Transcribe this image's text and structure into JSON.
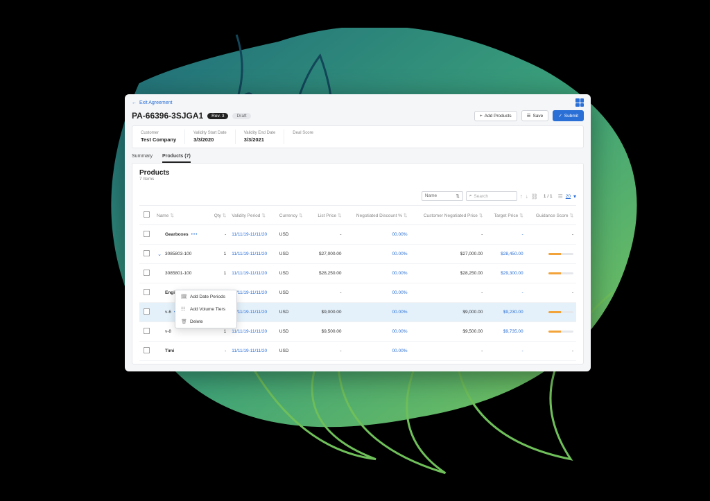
{
  "topbar": {
    "exit_label": "Exit Agreement"
  },
  "header": {
    "title": "PA-66396-3SJGA1",
    "rev_badge": "Rev. 3",
    "status_badge": "Draft",
    "add_products_btn": "Add Products",
    "save_btn": "Save",
    "submit_btn": "Submit"
  },
  "info": {
    "customer_label": "Customer",
    "customer_value": "Test Company",
    "start_label": "Validity Start Date",
    "start_value": "3/3/2020",
    "end_label": "Validity End Date",
    "end_value": "3/3/2021",
    "deal_score_label": "Deal Score",
    "deal_score_value": ""
  },
  "tabs": {
    "summary": "Summary",
    "products": "Products (7)"
  },
  "products": {
    "section_title": "Products",
    "item_count": "7 Items",
    "toolbar": {
      "name_filter": "Name",
      "search_placeholder": "Search",
      "pager": "1 / 1",
      "pagesize": "20"
    },
    "columns": {
      "name": "Name",
      "qty": "Qty",
      "validity": "Validity Period",
      "currency": "Currency",
      "list_price": "List Price",
      "neg_disc": "Negotiated Discount %",
      "cust_neg": "Customer Negotiated Price",
      "target": "Target Price",
      "guidance": "Guidance Score"
    },
    "rows": [
      {
        "name": "Gearboxes",
        "bold": true,
        "elips": true,
        "qty": "-",
        "validity": "11/11/19-11/11/20",
        "currency": "USD",
        "list_price": "-",
        "neg_disc": "00.00%",
        "cust_neg": "-",
        "target": "-",
        "guidance": false
      },
      {
        "name": "3085803-100",
        "bold": false,
        "caret": true,
        "elips": false,
        "qty": "1",
        "validity": "11/11/19-11/11/20",
        "currency": "USD",
        "list_price": "$27,000.00",
        "neg_disc": "00.00%",
        "cust_neg": "$27,000.00",
        "target": "$28,450.00",
        "guidance": true
      },
      {
        "name": "3085801-100",
        "bold": false,
        "elips": false,
        "qty": "1",
        "validity": "11/11/19-11/11/20",
        "currency": "USD",
        "list_price": "$28,250.00",
        "neg_disc": "00.00%",
        "cust_neg": "$28,250.00",
        "target": "$29,300.00",
        "guidance": true
      },
      {
        "name": "Engines",
        "bold": true,
        "elips": true,
        "qty": "-",
        "validity": "11/11/19-11/11/20",
        "currency": "USD",
        "list_price": "-",
        "neg_disc": "00.00%",
        "cust_neg": "-",
        "target": "-",
        "guidance": false
      },
      {
        "name": "v-6",
        "bold": false,
        "elips": true,
        "selected": true,
        "qty": "1",
        "validity": "11/11/19-11/11/20",
        "currency": "USD",
        "list_price": "$9,000.00",
        "neg_disc": "00.00%",
        "cust_neg": "$9,000.00",
        "target": "$9,230.00",
        "guidance": true
      },
      {
        "name": "v-8",
        "bold": false,
        "elips": false,
        "qty": "1",
        "validity": "11/11/19-11/11/20",
        "currency": "USD",
        "list_price": "$9,500.00",
        "neg_disc": "00.00%",
        "cust_neg": "$9,500.00",
        "target": "$9,735.00",
        "guidance": true
      },
      {
        "name": "Timi",
        "bold": true,
        "elips": false,
        "qty": "-",
        "validity": "11/11/19-11/11/20",
        "currency": "USD",
        "list_price": "-",
        "neg_disc": "00.00%",
        "cust_neg": "-",
        "target": "-",
        "guidance": false
      }
    ]
  },
  "context_menu": {
    "add_date_periods": "Add Date Periods",
    "add_volume_tiers": "Add Volume Tiers",
    "delete": "Delete"
  }
}
